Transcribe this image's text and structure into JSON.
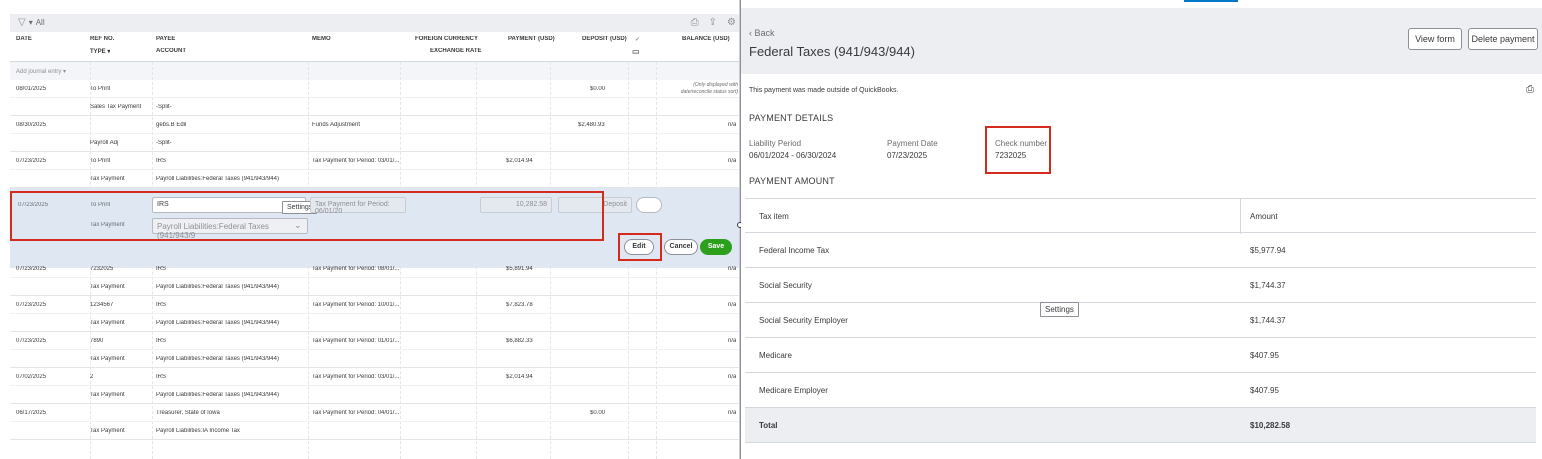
{
  "register": {
    "filter_label": "All",
    "columns": {
      "date": "DATE",
      "ref_no": "REF NO.",
      "type": "TYPE",
      "payee": "PAYEE",
      "account": "ACCOUNT",
      "memo": "MEMO",
      "foreign_currency": "FOREIGN CURRENCY",
      "exchange_rate": "EXCHANGE RATE",
      "payment": "PAYMENT (USD)",
      "deposit": "DEPOSIT (USD)",
      "balance": "BALANCE (USD)"
    },
    "add_journal_entry": "Add journal entry",
    "rows_top": [
      {
        "date": "08/01/2025",
        "ref": "To Print",
        "type": "Sales Tax Payment",
        "payee": "",
        "account": "-Split-",
        "memo": "",
        "payment": "",
        "deposit": "$0.00",
        "balance": "(Only displayed with date/reconcile status sort)"
      },
      {
        "date": "08/30/2025",
        "ref": "",
        "type": "Payroll Adj",
        "payee": "gebs.B Edil",
        "account": "-Split-",
        "memo": "Funds Adjustment",
        "payment": "",
        "deposit": "$2,480.93",
        "balance": "n/a"
      },
      {
        "date": "07/23/2025",
        "ref": "To Print",
        "type": "Tax Payment",
        "payee": "IRS",
        "account": "Payroll Liabilities:Federal Taxes (941/943/944)",
        "memo": "Tax Payment for Period: 03/01/...",
        "payment": "$2,014.94",
        "deposit": "",
        "balance": "n/a"
      }
    ],
    "editing_row": {
      "date": "07/23/2025",
      "ref": "To Print",
      "type": "Tax Payment",
      "payee": "IRS",
      "account": "Payroll Liabilities:Federal Taxes (941/943/9",
      "memo": "Tax Payment for Period: 06/01/20",
      "payment": "10,282.58",
      "deposit": "Deposit",
      "tooltip": "Settings",
      "edit_label": "Edit",
      "cancel_label": "Cancel",
      "save_label": "Save"
    },
    "rows_bottom": [
      {
        "date": "07/23/2025",
        "ref": "7232025",
        "type": "Tax Payment",
        "payee": "IRS",
        "account": "Payroll Liabilities:Federal Taxes (941/943/944)",
        "memo": "Tax Payment for Period: 08/01/...",
        "payment": "$5,891.94",
        "deposit": "",
        "balance": "n/a"
      },
      {
        "date": "07/23/2025",
        "ref": "1234567",
        "type": "Tax Payment",
        "payee": "IRS",
        "account": "Payroll Liabilities:Federal Taxes (941/943/944)",
        "memo": "Tax Payment for Period: 10/01/...",
        "payment": "$7,823.78",
        "deposit": "",
        "balance": "n/a"
      },
      {
        "date": "07/23/2025",
        "ref": "7890",
        "type": "Tax Payment",
        "payee": "IRS",
        "account": "Payroll Liabilities:Federal Taxes (941/943/944)",
        "memo": "Tax Payment for Period: 01/01/...",
        "payment": "$6,882.33",
        "deposit": "",
        "balance": "n/a"
      },
      {
        "date": "07/02/2025",
        "ref": "2",
        "type": "Tax Payment",
        "payee": "IRS",
        "account": "Payroll Liabilities:Federal Taxes (941/943/944)",
        "memo": "Tax Payment for Period: 03/01/...",
        "payment": "$2,014.94",
        "deposit": "",
        "balance": "n/a"
      },
      {
        "date": "06/17/2025",
        "ref": "",
        "type": "Tax Payment",
        "payee": "Treasurer, State of Iowa",
        "account": "Payroll Liabilities:IA Income Tax",
        "memo": "Tax Payment for Period: 04/01/...",
        "payment": "",
        "deposit": "$0.00",
        "balance": "n/a"
      }
    ]
  },
  "payment": {
    "back_label": "Back",
    "title": "Federal Taxes (941/943/944)",
    "view_form_label": "View form",
    "delete_label": "Delete payment",
    "note": "This payment was made outside of QuickBooks.",
    "details_heading": "PAYMENT DETAILS",
    "liability_period_label": "Liability Period",
    "liability_period_value": "06/01/2024 - 06/30/2024",
    "payment_date_label": "Payment Date",
    "payment_date_value": "07/23/2025",
    "check_number_label": "Check number",
    "check_number_value": "7232025",
    "amount_heading": "PAYMENT AMOUNT",
    "table_headers": {
      "item": "Tax item",
      "amount": "Amount"
    },
    "items": [
      {
        "name": "Federal Income Tax",
        "amount": "$5,977.94"
      },
      {
        "name": "Social Security",
        "amount": "$1,744.37"
      },
      {
        "name": "Social Security Employer",
        "amount": "$1,744.37"
      },
      {
        "name": "Medicare",
        "amount": "$407.95"
      },
      {
        "name": "Medicare Employer",
        "amount": "$407.95"
      }
    ],
    "total_label": "Total",
    "total_value": "$10,282.58",
    "tooltip": "Settings"
  },
  "colors": {
    "highlight": "#d52b1e",
    "save_green": "#2ca01c",
    "edit_row": "#dfe7f2"
  }
}
